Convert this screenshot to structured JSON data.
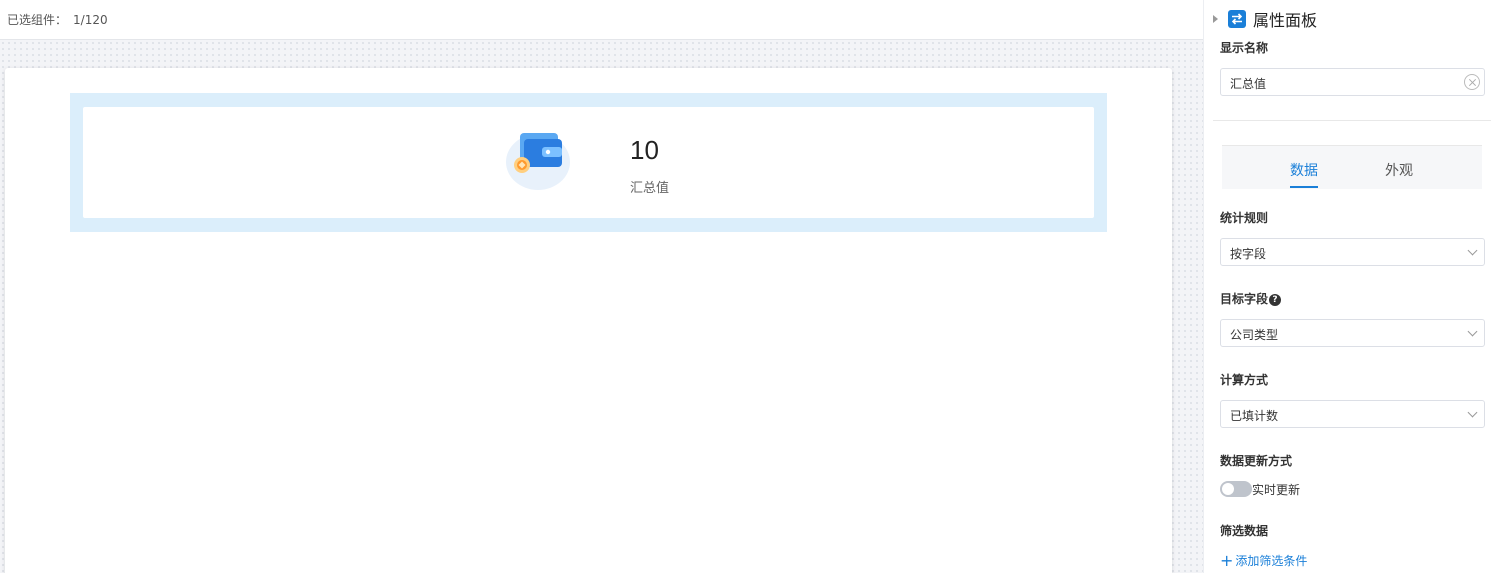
{
  "toolbar": {
    "selected_label": "已选组件：",
    "selected_count": "1/120"
  },
  "widget": {
    "value": "10",
    "label": "汇总值",
    "icon": "wallet-icon"
  },
  "panel": {
    "title": "属性面板",
    "display_name": {
      "label": "显示名称",
      "value": "汇总值"
    },
    "tabs": [
      {
        "label": "数据",
        "active": true
      },
      {
        "label": "外观",
        "active": false
      }
    ],
    "stat_rule": {
      "label": "统计规则",
      "value": "按字段"
    },
    "target_field": {
      "label": "目标字段",
      "value": "公司类型"
    },
    "calc_method": {
      "label": "计算方式",
      "value": "已填计数"
    },
    "update_mode": {
      "label": "数据更新方式",
      "toggle_label": "实时更新",
      "enabled": false
    },
    "filter": {
      "label": "筛选数据",
      "add_label": "添加筛选条件"
    }
  },
  "colors": {
    "accent": "#1a7fd8",
    "selection": "#dbeefb"
  }
}
